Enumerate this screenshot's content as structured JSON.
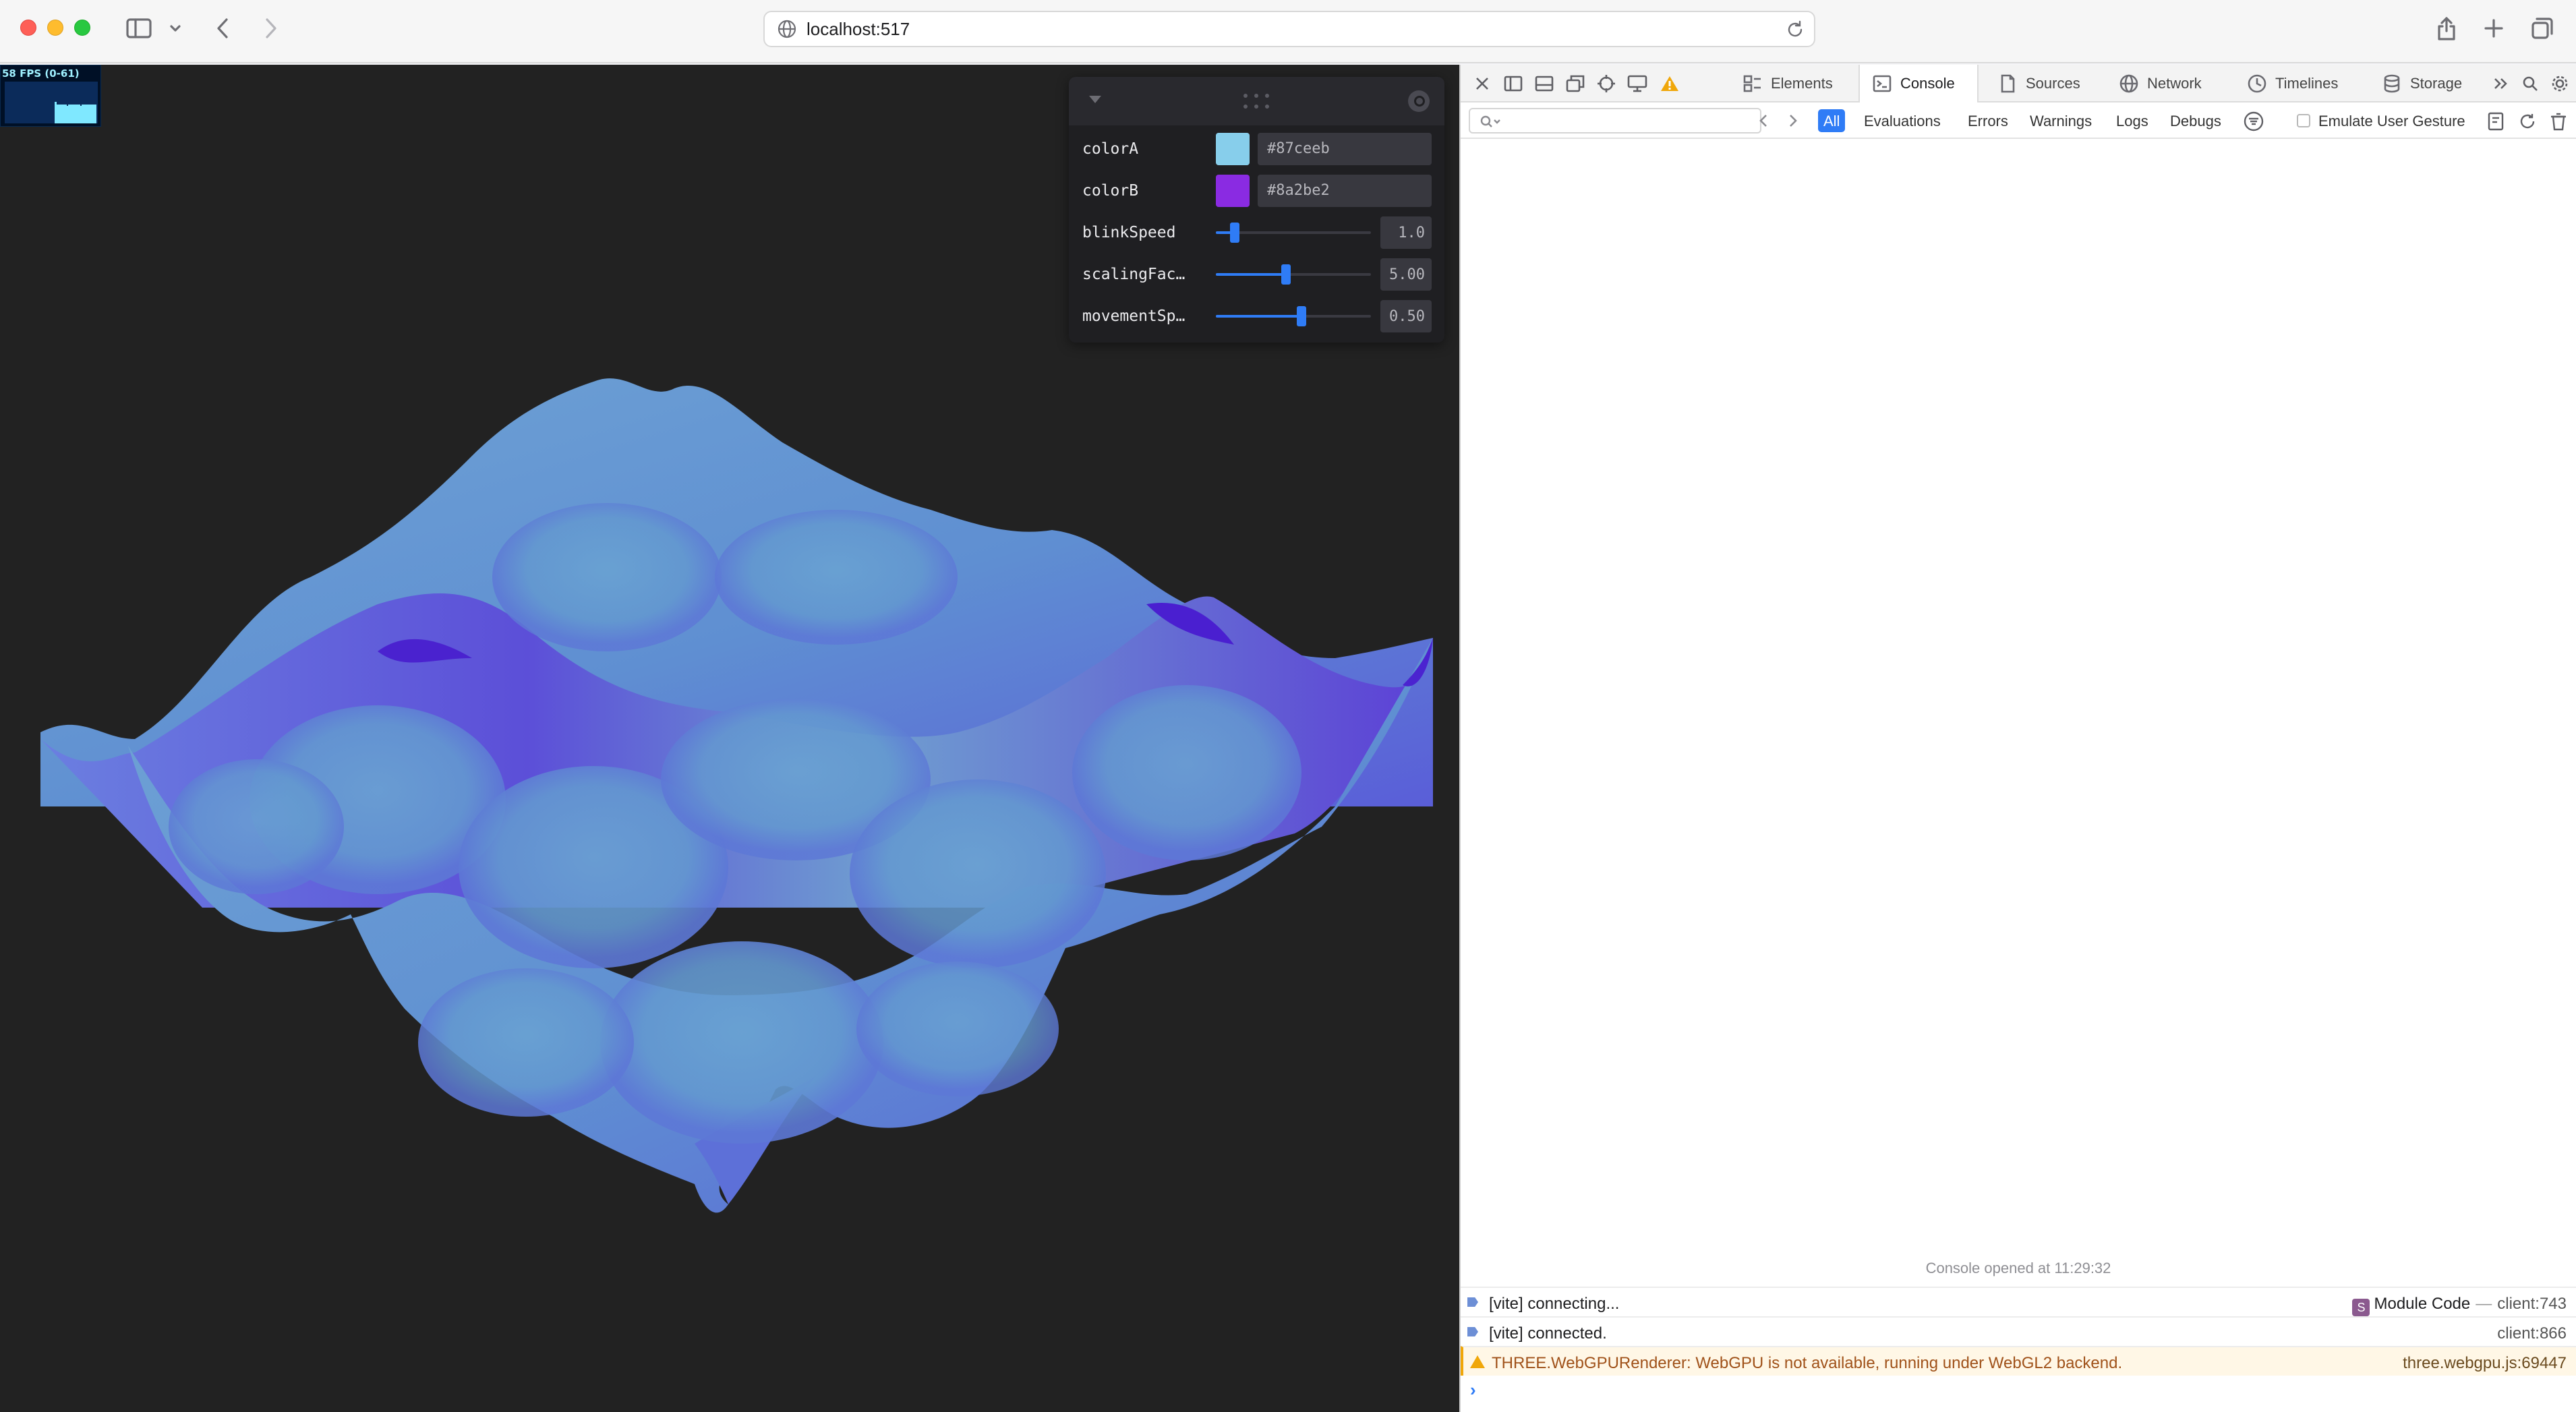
{
  "browser": {
    "url": "localhost:517",
    "icons": [
      "sidebar-icon",
      "chevron-down-icon",
      "back-icon",
      "forward-icon",
      "globe-icon",
      "reload-icon",
      "share-icon",
      "plus-icon",
      "tabs-icon"
    ]
  },
  "stats": {
    "fps_text": "58 FPS (0-61)"
  },
  "gui": {
    "controls": [
      {
        "label": "colorA",
        "type": "color",
        "value": "#87ceeb",
        "color": "#87ceeb"
      },
      {
        "label": "colorB",
        "type": "color",
        "value": "#8a2be2",
        "color": "#8a2be2"
      },
      {
        "label": "blinkSpeed",
        "type": "slider",
        "value": "1.0",
        "fraction": 0.12
      },
      {
        "label": "scalingFac…",
        "type": "slider",
        "value": "5.00",
        "fraction": 0.45
      },
      {
        "label": "movementSp…",
        "type": "slider",
        "value": "0.50",
        "fraction": 0.55
      }
    ]
  },
  "devtools": {
    "tabs": [
      {
        "label": "Elements",
        "icon": "elements-icon"
      },
      {
        "label": "Console",
        "icon": "console-icon"
      },
      {
        "label": "Sources",
        "icon": "sources-icon"
      },
      {
        "label": "Network",
        "icon": "network-icon"
      },
      {
        "label": "Timelines",
        "icon": "timelines-icon"
      },
      {
        "label": "Storage",
        "icon": "storage-icon"
      }
    ],
    "active_tab": "Console",
    "levels": [
      "All",
      "Evaluations",
      "Errors",
      "Warnings",
      "Logs",
      "Debugs"
    ],
    "emulate_label": "Emulate User Gesture",
    "console_opened": "Console opened at 11:29:32",
    "logs": [
      {
        "message": "[vite] connecting...",
        "module_badge": "S",
        "module": "Module Code",
        "source": "client:743",
        "level": "log"
      },
      {
        "message": "[vite] connected.",
        "source": "client:866",
        "level": "log"
      },
      {
        "message": "THREE.WebGPURenderer: WebGPU is not available, running under WebGL2 backend.",
        "source": "three.webgpu.js:69447",
        "level": "warning"
      }
    ],
    "prompt": "›"
  },
  "colors": {
    "accent": "#2f7cf6",
    "canvas_bg": "#222222",
    "wave_light": "#6aa0cf",
    "wave_dark": "#4a1fd0"
  }
}
